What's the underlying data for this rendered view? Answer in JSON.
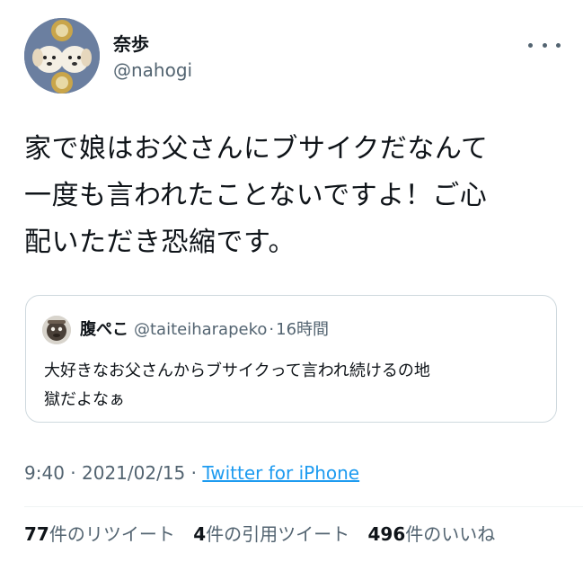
{
  "author": {
    "name": "奈歩",
    "handle": "@nahogi"
  },
  "tweet_text_lines": [
    "家で娘はお父さんにブサイクだなんて",
    "一度も言われたことないですよ！ご心",
    "配いただき恐縮です。"
  ],
  "quoted": {
    "name": "腹ぺこ",
    "handle": "@taiteiharapeko",
    "separator": "·",
    "time": "16時間",
    "text_lines": [
      "大好きなお父さんからブサイクって言われ続けるの地",
      "獄だよなぁ"
    ]
  },
  "meta": {
    "time": "9:40",
    "sep1": " · ",
    "date": "2021/02/15",
    "sep2": " · ",
    "source": "Twitter for iPhone"
  },
  "stats": {
    "retweets_count": "77",
    "retweets_label": "件のリツイート",
    "quotes_count": "4",
    "quotes_label": "件の引用ツイート",
    "likes_count": "496",
    "likes_label": "件のいいね"
  },
  "colors": {
    "text": "#0f1419",
    "secondary": "#536471",
    "link": "#1d9bf0",
    "border": "#cfd9de"
  },
  "icons": {
    "more": "more-horizontal-icon"
  }
}
